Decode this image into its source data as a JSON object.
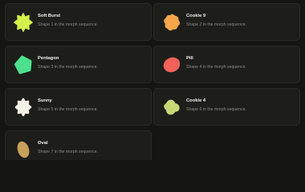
{
  "shapes": [
    {
      "name": "Soft Burst",
      "description": "Shape 1 in the morph sequence.",
      "color": "#d4f04a"
    },
    {
      "name": "Cookie 9",
      "description": "Shape 2 in the morph sequence.",
      "color": "#f6a54b"
    },
    {
      "name": "Pentagon",
      "description": "Shape 3 in the morph sequence.",
      "color": "#4ce08f"
    },
    {
      "name": "Pill",
      "description": "Shape 4 in the morph sequence.",
      "color": "#f0625a"
    },
    {
      "name": "Sunny",
      "description": "Shape 5 in the morph sequence.",
      "color": "#f4f1e6"
    },
    {
      "name": "Cookie 4",
      "description": "Shape 6 in the morph sequence.",
      "color": "#c8d776"
    },
    {
      "name": "Oval",
      "description": "Shape 7 in the morph sequence.",
      "color": "#c9a05a"
    }
  ]
}
